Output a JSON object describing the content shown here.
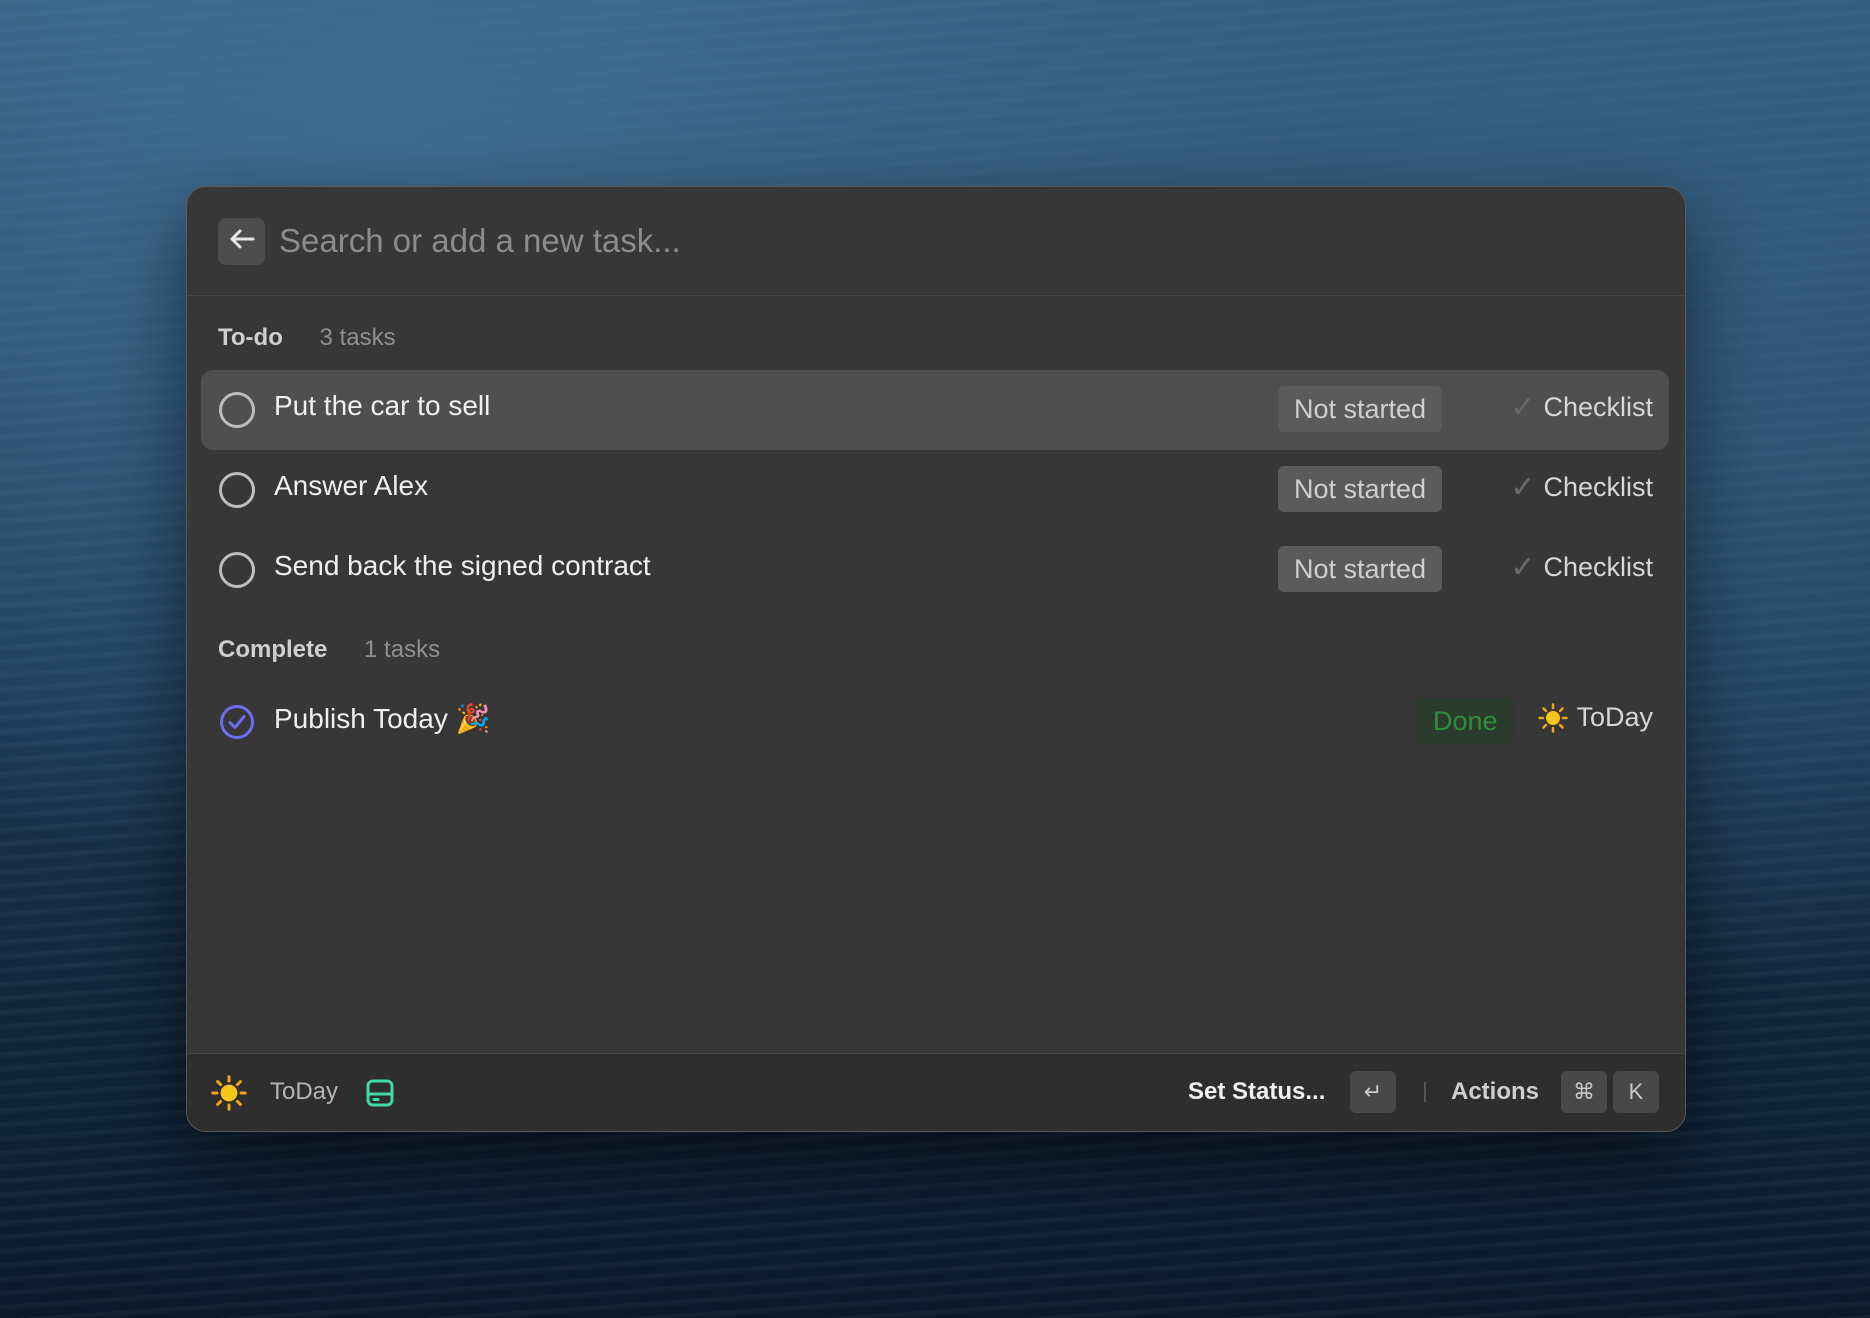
{
  "search": {
    "placeholder": "Search or add a new task..."
  },
  "sections": {
    "todo": {
      "title": "To-do",
      "count": "3 tasks",
      "tasks": [
        {
          "title": "Put the car to sell",
          "status": "Not started",
          "tag": "Checklist"
        },
        {
          "title": "Answer Alex",
          "status": "Not started",
          "tag": "Checklist"
        },
        {
          "title": "Send back the signed contract",
          "status": "Not started",
          "tag": "Checklist"
        }
      ]
    },
    "complete": {
      "title": "Complete",
      "count": "1 tasks",
      "tasks": [
        {
          "title": "Publish Today 🎉",
          "status": "Done",
          "tag": "ToDay"
        }
      ]
    }
  },
  "footer": {
    "app_name": "ToDay",
    "primary_action": "Set Status...",
    "enter_key": "↵",
    "actions_label": "Actions",
    "cmd_key": "⌘",
    "k_key": "K"
  },
  "colors": {
    "accent_purple": "#6b6ef0",
    "done_green": "#2e8f38",
    "sun_yellow": "#f5c518",
    "inbox_teal": "#3fd9a8"
  }
}
